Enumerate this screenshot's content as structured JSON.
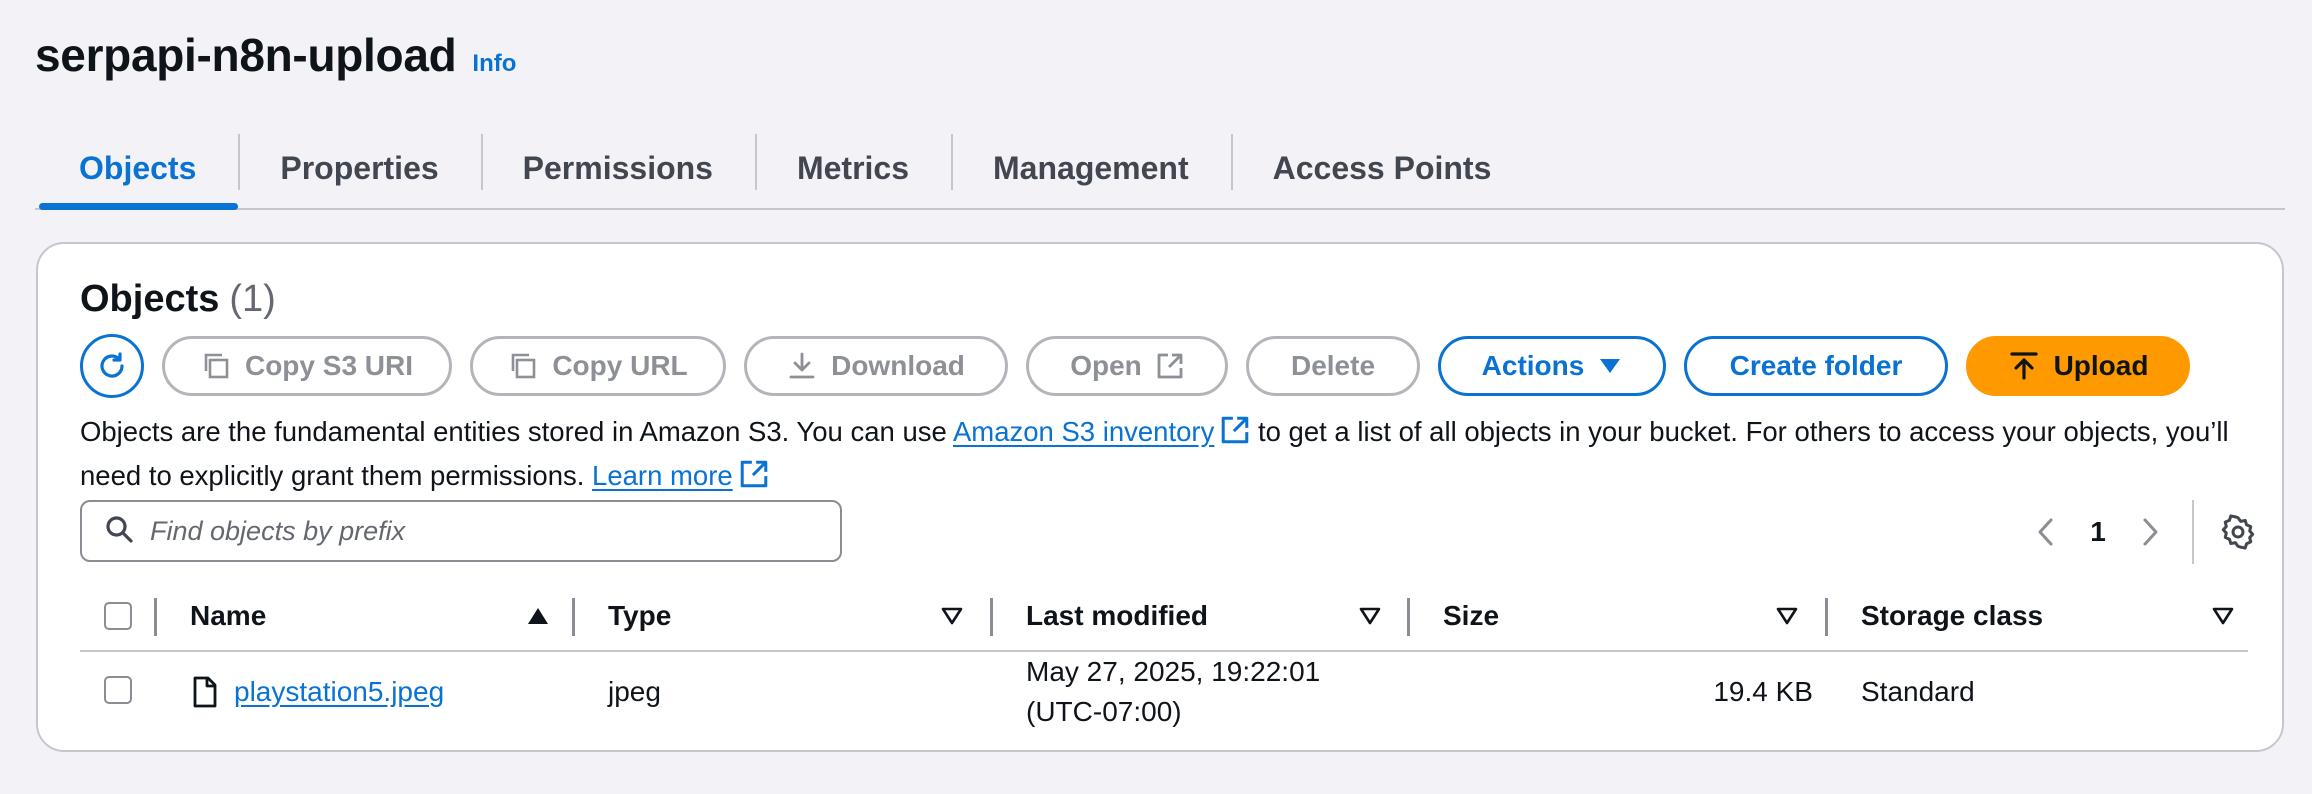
{
  "header": {
    "title": "serpapi-n8n-upload",
    "info": "Info"
  },
  "tabs": [
    {
      "label": "Objects",
      "active": true
    },
    {
      "label": "Properties"
    },
    {
      "label": "Permissions"
    },
    {
      "label": "Metrics"
    },
    {
      "label": "Management"
    },
    {
      "label": "Access Points"
    }
  ],
  "panel": {
    "title": "Objects",
    "count": "(1)",
    "toolbar": {
      "copy_s3_uri": "Copy S3 URI",
      "copy_url": "Copy URL",
      "download": "Download",
      "open": "Open",
      "delete": "Delete",
      "actions": "Actions",
      "create_folder": "Create folder",
      "upload": "Upload"
    },
    "description": {
      "part1": "Objects are the fundamental entities stored in Amazon S3. You can use ",
      "link1": "Amazon S3 inventory",
      "part2": " to get a list of all objects in your bucket. For others to access your objects, you’ll need to explicitly grant them permissions. ",
      "link2": "Learn more"
    },
    "search": {
      "placeholder": "Find objects by prefix",
      "value": ""
    },
    "pagination": {
      "page": "1"
    },
    "table": {
      "columns": [
        "Name",
        "Type",
        "Last modified",
        "Size",
        "Storage class"
      ],
      "rows": [
        {
          "name": "playstation5.jpeg",
          "type": "jpeg",
          "last_modified_line1": "May 27, 2025, 19:22:01",
          "last_modified_line2": "(UTC-07:00)",
          "size": "19.4 KB",
          "storage_class": "Standard"
        }
      ]
    }
  },
  "colors": {
    "accent": "#0972d3",
    "upload": "#ff9900",
    "disabled": "#8d9096"
  },
  "icons": [
    "refresh-icon",
    "copy-icon",
    "download-icon",
    "external-link-icon",
    "caret-down-icon",
    "upload-icon",
    "search-icon",
    "chevron-left-icon",
    "chevron-right-icon",
    "settings-icon",
    "file-icon",
    "sort-ascending-icon",
    "sort-descending-icon"
  ]
}
